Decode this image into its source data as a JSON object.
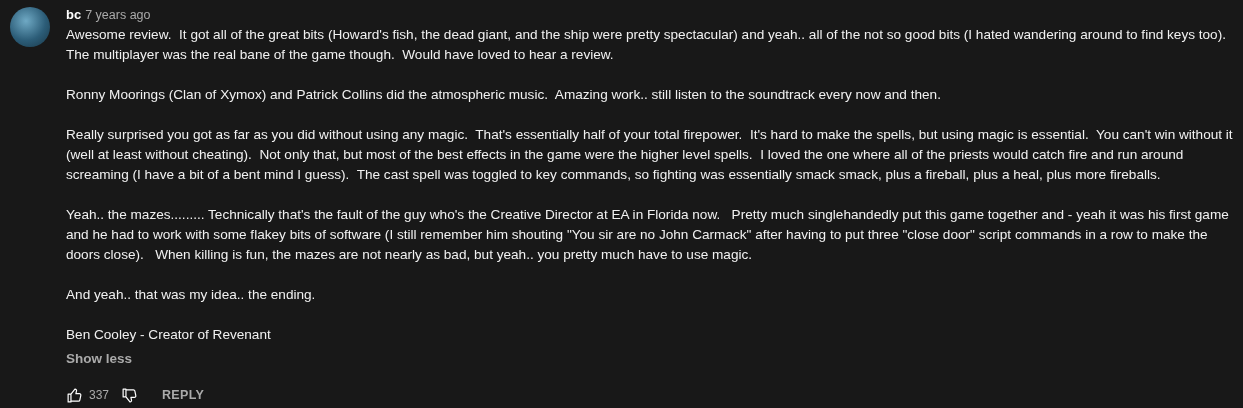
{
  "comment": {
    "author": "bc",
    "time": "7 years ago",
    "paragraphs": [
      "Awesome review.  It got all of the great bits (Howard's fish, the dead giant, and the ship were pretty spectacular) and yeah.. all of the not so good bits (I hated wandering around to find keys too).   The multiplayer was the real bane of the game though.  Would have loved to hear a review.",
      "Ronny Moorings (Clan of Xymox) and Patrick Collins did the atmospheric music.  Amazing work.. still listen to the soundtrack every now and then.",
      "Really surprised you got as far as you did without using any magic.  That's essentially half of your total firepower.  It's hard to make the spells, but using magic is essential.  You can't win without it (well at least without cheating).  Not only that, but most of the best effects in the game were the higher level spells.  I loved the one where all of the priests would catch fire and run around screaming (I have a bit of a bent mind I guess).  The cast spell was toggled to key commands, so fighting was essentially smack smack, plus a fireball, plus a heal, plus more fireballs.",
      "Yeah.. the mazes......... Technically that's the fault of the guy who's the Creative Director at EA in Florida now.   Pretty much singlehandedly put this game together and - yeah it was his first game and he had to work with some flakey bits of software (I still remember him shouting \"You sir are no John Carmack\" after having to put three \"close door\" script commands in a row to make the doors close).   When killing is fun, the mazes are not nearly as bad, but yeah.. you pretty much have to use magic.",
      "And yeah.. that was my idea.. the ending.",
      "Ben Cooley - Creator of Revenant"
    ],
    "toggle": "Show less",
    "likes": "337",
    "reply": "REPLY"
  }
}
